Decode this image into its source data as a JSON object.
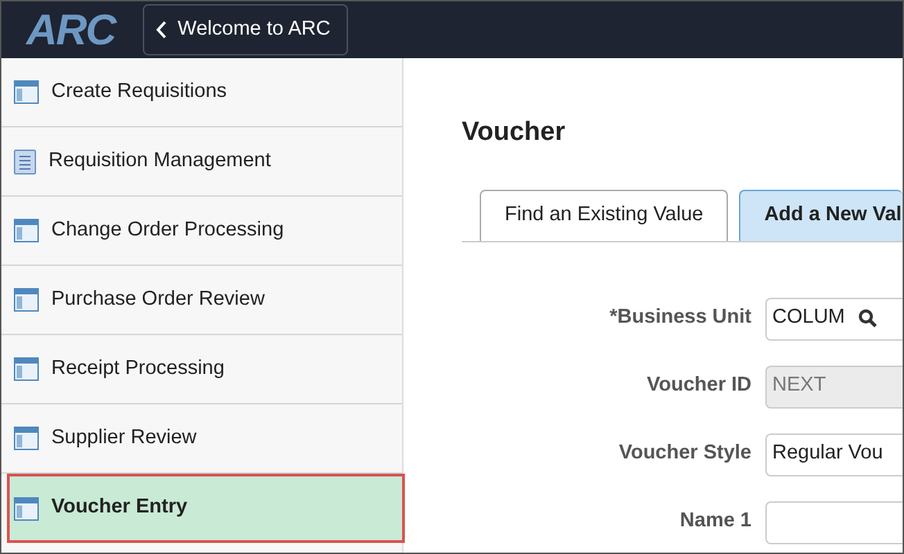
{
  "header": {
    "logo": "ARC",
    "back_button": "Welcome to ARC"
  },
  "sidebar": {
    "items": [
      {
        "label": "Create Requisitions",
        "kind": "page",
        "selected": false
      },
      {
        "label": "Requisition Management",
        "kind": "list",
        "selected": false
      },
      {
        "label": "Change Order Processing",
        "kind": "page",
        "selected": false
      },
      {
        "label": "Purchase Order Review",
        "kind": "page",
        "selected": false
      },
      {
        "label": "Receipt Processing",
        "kind": "page",
        "selected": false
      },
      {
        "label": "Supplier Review",
        "kind": "page",
        "selected": false
      },
      {
        "label": "Voucher Entry",
        "kind": "page",
        "selected": true
      }
    ]
  },
  "page_title": "Voucher",
  "tabs": [
    {
      "label": "Find an Existing Value",
      "selected": false
    },
    {
      "label": "Add a New Val",
      "selected": true
    }
  ],
  "form": [
    {
      "label": "*Business Unit",
      "kind": "lookup",
      "value": "COLUM",
      "disabled": false
    },
    {
      "label": "Voucher ID",
      "kind": "text",
      "value": "NEXT",
      "disabled": true
    },
    {
      "label": "Voucher Style",
      "kind": "select",
      "value": "Regular Vou",
      "disabled": false
    },
    {
      "label": "Name 1",
      "kind": "text",
      "disabled": false
    }
  ]
}
